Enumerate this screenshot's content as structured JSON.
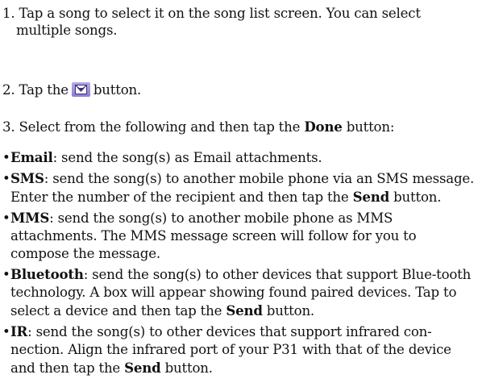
{
  "steps": {
    "s1": "1. Tap a song to select it on the song list screen. You can select multiple songs.",
    "s2_pre": "2. Tap the",
    "s2_icon": "envelope-icon",
    "s2_post": "button.",
    "s3_pre": "3. Select from the following and then tap the ",
    "s3_bold": "Done",
    "s3_post": " button:"
  },
  "options": [
    {
      "name": "Email",
      "text": ": send the song(s) as Email attachments.",
      "send_bold": "",
      "tail": ""
    },
    {
      "name": "SMS",
      "text": ": send the song(s) to another mobile phone via an SMS message. Enter the number of the recipient and then tap the ",
      "send_bold": "Send",
      "tail": " button."
    },
    {
      "name": "MMS",
      "text": ": send the song(s) to another mobile phone as MMS attachments. The MMS message screen will follow for you to compose the message.",
      "send_bold": "",
      "tail": ""
    },
    {
      "name": "Bluetooth",
      "text": ": send the song(s) to other devices that support Blue-tooth technology. A box will appear showing found paired devices. Tap to select a device and then tap the ",
      "send_bold": "Send",
      "tail": " button."
    },
    {
      "name": "IR",
      "text": ": send the song(s) to other devices that support infrared con-nection. Align the infrared port of your P31 with that of the device and then tap the ",
      "send_bold": "Send",
      "tail": " button."
    }
  ],
  "colors": {
    "icon_bg": "#a898e0",
    "text": "#111111"
  }
}
